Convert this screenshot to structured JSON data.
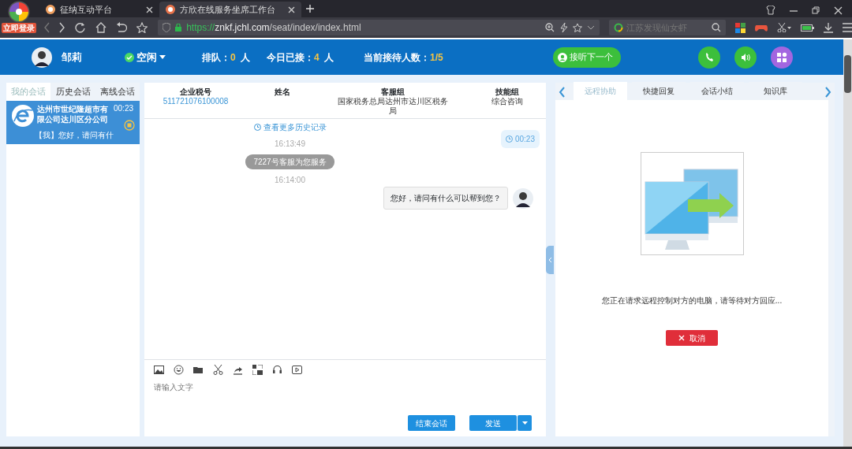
{
  "browser": {
    "login_badge": "立即登录",
    "tabs": [
      {
        "title": "征纳互动平台",
        "selected": false
      },
      {
        "title": "方欣在线服务坐席工作台",
        "selected": true
      }
    ],
    "url": {
      "scheme": "https://",
      "host": "znkf.jchl.com",
      "path": "/seat/index/index.html"
    },
    "search": {
      "placeholder": "江苏发现仙女虾"
    }
  },
  "header": {
    "agent_name": "邹莉",
    "status": "空闲",
    "stats": [
      {
        "label": "排队：",
        "value": "0",
        "unit": "人"
      },
      {
        "label": "今日已接：",
        "value": "4",
        "unit": "人"
      },
      {
        "label": "当前接待人数：",
        "value": "1/5"
      }
    ],
    "next_button": "接听下一个"
  },
  "session_tabs": [
    {
      "label": "我的会话",
      "selected": true
    },
    {
      "label": "历史会话",
      "selected": false
    },
    {
      "label": "离线会话",
      "selected": false
    }
  ],
  "sessions": [
    {
      "company": "达州市世纪隆超市有限公司达川区分公司",
      "time": "00:23",
      "preview": "【我】您好，请问有什",
      "selected": true
    }
  ],
  "customer_info": [
    {
      "label": "企业税号",
      "value": "511721076100008"
    },
    {
      "label": "姓名"
    },
    {
      "label": "客服组",
      "value": "国家税务总局达州市达川区税务局"
    },
    {
      "label": "技能组",
      "value": "综合咨询"
    }
  ],
  "chat": {
    "history_link": "查看更多历史记录",
    "timer": "00:23",
    "messages": [
      {
        "kind": "time",
        "text": "16:13:49"
      },
      {
        "kind": "system",
        "text": "7227号客服为您服务"
      },
      {
        "kind": "time",
        "text": "16:14:00"
      },
      {
        "kind": "agent",
        "text": "您好，请问有什么可以帮到您？"
      }
    ]
  },
  "composer": {
    "placeholder": "请输入文字",
    "end_button": "结束会话",
    "send_button": "发送"
  },
  "right_panel": {
    "tabs": [
      {
        "label": "远程协助",
        "selected": true
      },
      {
        "label": "快捷回复",
        "selected": false
      },
      {
        "label": "会话小结",
        "selected": false
      },
      {
        "label": "知识库",
        "selected": false
      }
    ],
    "message": "您正在请求远程控制对方的电脑，请等待对方回应...",
    "cancel_button": "取消"
  }
}
